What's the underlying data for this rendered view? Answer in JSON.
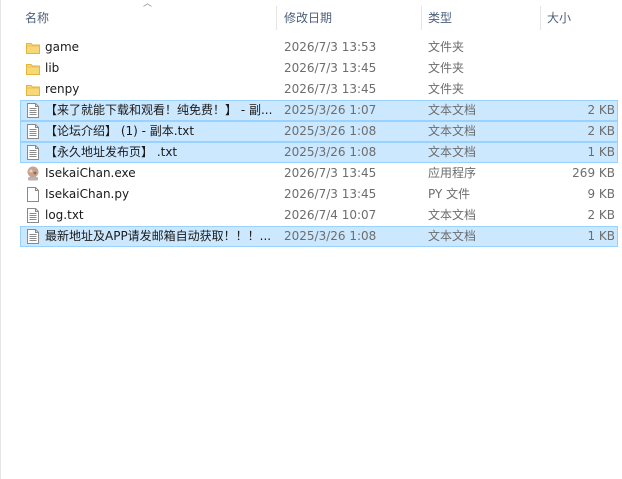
{
  "columns": {
    "name": "名称",
    "date": "修改日期",
    "type": "类型",
    "size": "大小"
  },
  "files": [
    {
      "name": "game",
      "date": "2026/7/3 13:53",
      "type": "文件夹",
      "size": "",
      "icon": "folder-icon",
      "selected": false
    },
    {
      "name": "lib",
      "date": "2026/7/3 13:45",
      "type": "文件夹",
      "size": "",
      "icon": "folder-icon",
      "selected": false
    },
    {
      "name": "renpy",
      "date": "2026/7/3 13:45",
      "type": "文件夹",
      "size": "",
      "icon": "folder-icon",
      "selected": false
    },
    {
      "name": "【来了就能下载和观看！纯免费！】 - 副...",
      "date": "2025/3/26 1:07",
      "type": "文本文档",
      "size": "2 KB",
      "icon": "text-file-icon",
      "selected": true
    },
    {
      "name": "【论坛介绍】 (1) - 副本.txt",
      "date": "2025/3/26 1:08",
      "type": "文本文档",
      "size": "2 KB",
      "icon": "text-file-icon",
      "selected": true
    },
    {
      "name": "【永久地址发布页】 .txt",
      "date": "2025/3/26 1:08",
      "type": "文本文档",
      "size": "1 KB",
      "icon": "text-file-icon",
      "selected": true
    },
    {
      "name": "IsekaiChan.exe",
      "date": "2026/7/3 13:45",
      "type": "应用程序",
      "size": "269 KB",
      "icon": "app-icon",
      "selected": false
    },
    {
      "name": "IsekaiChan.py",
      "date": "2026/7/3 13:45",
      "type": "PY 文件",
      "size": "9 KB",
      "icon": "file-icon",
      "selected": false
    },
    {
      "name": "log.txt",
      "date": "2026/7/4 10:07",
      "type": "文本文档",
      "size": "2 KB",
      "icon": "text-file-icon",
      "selected": false
    },
    {
      "name": "最新地址及APP请发邮箱自动获取！！！...",
      "date": "2025/3/26 1:08",
      "type": "文本文档",
      "size": "1 KB",
      "icon": "text-file-icon",
      "selected": true
    }
  ]
}
